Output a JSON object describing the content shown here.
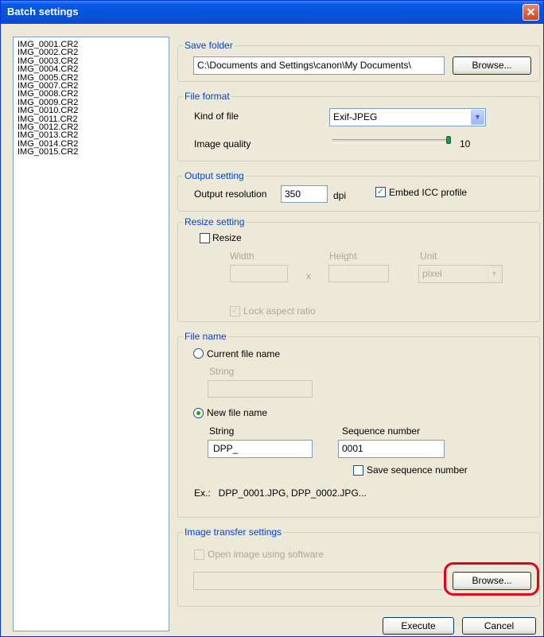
{
  "window": {
    "title": "Batch settings",
    "close_glyph": "✕"
  },
  "files": [
    "IMG_0001.CR2",
    "IMG_0002.CR2",
    "IMG_0003.CR2",
    "IMG_0004.CR2",
    "IMG_0005.CR2",
    "IMG_0007.CR2",
    "IMG_0008.CR2",
    "IMG_0009.CR2",
    "IMG_0010.CR2",
    "IMG_0011.CR2",
    "IMG_0012.CR2",
    "IMG_0013.CR2",
    "IMG_0014.CR2",
    "IMG_0015.CR2"
  ],
  "save_folder": {
    "label": "Save folder",
    "path": "C:\\Documents and Settings\\canon\\My Documents\\",
    "browse": "Browse..."
  },
  "file_format": {
    "label": "File format",
    "kind_label": "Kind of file",
    "kind_value": "Exif-JPEG",
    "quality_label": "Image quality",
    "quality_value": "10",
    "quality_max": 10
  },
  "output": {
    "label": "Output setting",
    "resolution_label": "Output resolution",
    "resolution_value": "350",
    "unit": "dpi",
    "embed_icc_label": "Embed ICC profile",
    "embed_icc_checked": true
  },
  "resize": {
    "label": "Resize setting",
    "resize_label": "Resize",
    "resize_checked": false,
    "width_label": "Width",
    "height_label": "Height",
    "unit_label": "Unit",
    "unit_value": "pixel",
    "x_sep": "x",
    "lock_label": "Lock aspect ratio",
    "lock_checked": true
  },
  "file_name": {
    "label": "File name",
    "current_label": "Current file name",
    "current_string_label": "String",
    "new_label": "New file name",
    "new_string_label": "String",
    "new_string_value": "DPP_",
    "seq_label": "Sequence number",
    "seq_value": "0001",
    "save_seq_label": "Save sequence number",
    "example": "Ex.:   DPP_0001.JPG, DPP_0002.JPG..."
  },
  "transfer": {
    "label": "Image transfer settings",
    "open_label": "Open image using software",
    "browse": "Browse..."
  },
  "footer": {
    "execute": "Execute",
    "cancel": "Cancel"
  },
  "colors": {
    "title_bar": "#0a58e8",
    "group_label": "#0046d5",
    "check_mark": "#21a121",
    "highlight": "#e4001b"
  },
  "icons": {
    "check": "✓",
    "dropdown": "▼"
  }
}
